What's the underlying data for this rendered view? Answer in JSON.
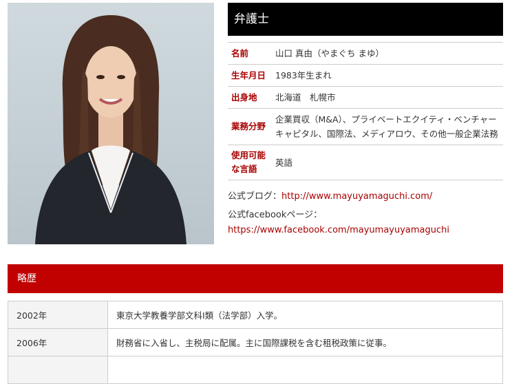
{
  "header": {
    "title": "弁護士"
  },
  "profile": {
    "photo_name": "profile-photo",
    "rows": [
      {
        "label": "名前",
        "value": "山口 真由（やまぐち まゆ）"
      },
      {
        "label": "生年月日",
        "value": "1983年生まれ"
      },
      {
        "label": "出身地",
        "value": "北海道　札幌市"
      },
      {
        "label": "業務分野",
        "value": "企業買収（M&A）、プライベートエクイティ・ベンチャーキャピタル、国際法、メディアロウ、その他一般企業法務"
      },
      {
        "label": "使用可能な言語",
        "value": "英語"
      }
    ]
  },
  "links": {
    "blog_label": "公式ブログ：",
    "blog_url": "http://www.mayuyamaguchi.com/",
    "facebook_label": "公式facebookページ：",
    "facebook_url": "https://www.facebook.com/mayumayuyamaguchi"
  },
  "career": {
    "heading": "略歴",
    "rows": [
      {
        "year": "2002年",
        "text": "東京大学教養学部文科Ⅰ類（法学部）入学。"
      },
      {
        "year": "2006年",
        "text": "財務省に入省し、主税局に配属。主に国際課税を含む租税政策に従事。"
      },
      {
        "year": "",
        "text": ""
      }
    ]
  },
  "colors": {
    "accent": "#c10000",
    "label_red": "#a80000",
    "title_bg": "#000000"
  }
}
